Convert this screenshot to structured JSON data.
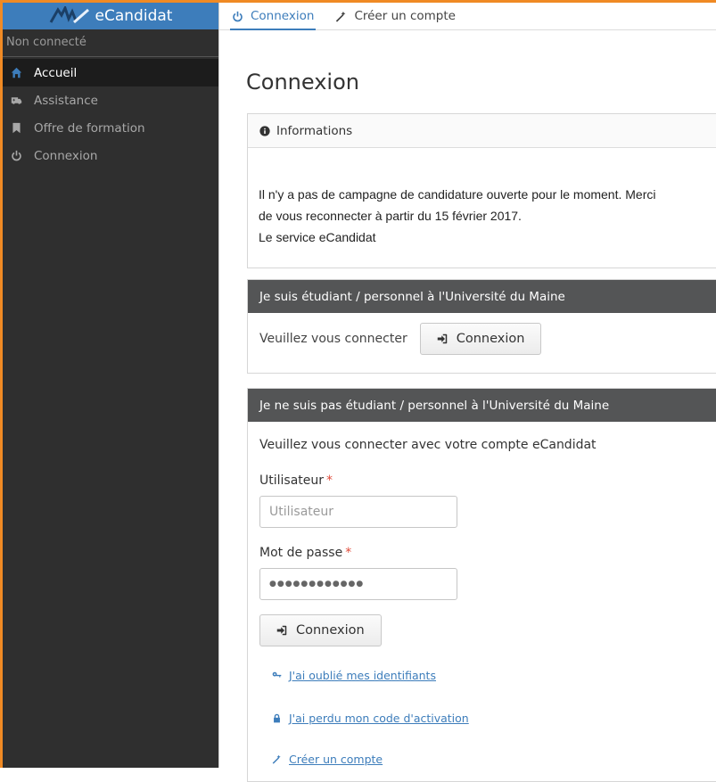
{
  "app": {
    "name": "eCandidat",
    "accent": "#3d7dbb",
    "frame_color": "#f08a24"
  },
  "sidebar": {
    "status": "Non connecté",
    "items": [
      {
        "label": "Accueil",
        "icon": "home-icon",
        "active": true
      },
      {
        "label": "Assistance",
        "icon": "ambulance-icon",
        "active": false
      },
      {
        "label": "Offre de formation",
        "icon": "bookmark-icon",
        "active": false
      },
      {
        "label": "Connexion",
        "icon": "power-icon",
        "active": false
      }
    ]
  },
  "tabs": [
    {
      "label": "Connexion",
      "icon": "power-icon",
      "active": true
    },
    {
      "label": "Créer un compte",
      "icon": "magic-wand-icon",
      "active": false
    }
  ],
  "page": {
    "title": "Connexion"
  },
  "info_panel": {
    "heading": "Informations",
    "lines": [
      "Il n'y a pas de campagne de candidature ouverte pour le moment. Merci",
      "de vous reconnecter à partir du 15 février 2017.",
      "Le service eCandidat"
    ]
  },
  "student_panel": {
    "heading": "Je suis étudiant / personnel à l'Université du Maine",
    "prompt": "Veuillez vous connecter",
    "button": "Connexion"
  },
  "external_panel": {
    "heading": "Je ne suis pas étudiant / personnel à l'Université du Maine",
    "prompt": "Veuillez vous connecter avec votre compte eCandidat",
    "user_label": "Utilisateur",
    "user_placeholder": "Utilisateur",
    "password_label": "Mot de passe",
    "password_value": "●●●●●●●●●●●●",
    "required_mark": "*",
    "button": "Connexion",
    "links": [
      {
        "label": "J'ai oublié mes identifiants",
        "icon": "key-icon"
      },
      {
        "label": "J'ai perdu mon code d'activation",
        "icon": "lock-icon"
      },
      {
        "label": "Créer un compte",
        "icon": "magic-wand-icon"
      }
    ]
  }
}
